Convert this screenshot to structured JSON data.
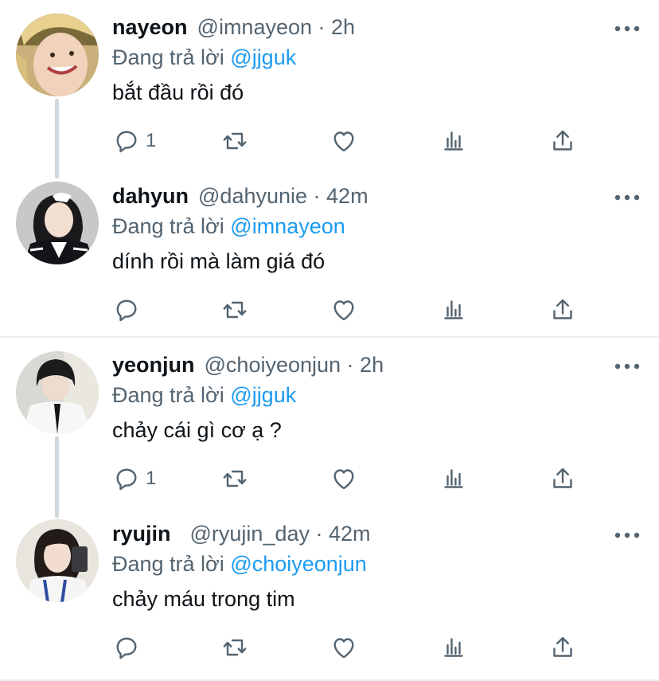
{
  "reply_prefix": "Đang trả lời",
  "threads": [
    {
      "tweets": [
        {
          "name": "nayeon",
          "handle": "@imnayeon",
          "time": "2h",
          "reply_to": "@jjguk",
          "text": "bắt đầu rồi đó",
          "reply_count": "1"
        },
        {
          "name": "dahyun",
          "handle": "@dahyunie",
          "time": "42m",
          "reply_to": "@imnayeon",
          "text": "dính rồi mà làm giá đó",
          "reply_count": ""
        }
      ]
    },
    {
      "tweets": [
        {
          "name": "yeonjun",
          "handle": "@choiyeonjun",
          "time": "2h",
          "reply_to": "@jjguk",
          "text": "chảy cái gì cơ ạ ?",
          "reply_count": "1"
        },
        {
          "name": "ryujin",
          "handle": "@ryujin_day",
          "time": "42m",
          "reply_to": "@choiyeonjun",
          "text": "chảy máu trong tim",
          "reply_count": ""
        }
      ]
    }
  ],
  "icons": {
    "reply": "reply-icon",
    "retweet": "retweet-icon",
    "like": "heart-icon",
    "views": "views-icon",
    "share": "share-icon",
    "more": "more-icon"
  },
  "colors": {
    "accent": "#1d9bf0",
    "muted": "#536471",
    "text": "#0f1419",
    "divider": "#e6ecf0",
    "connector": "#cfd9de"
  }
}
